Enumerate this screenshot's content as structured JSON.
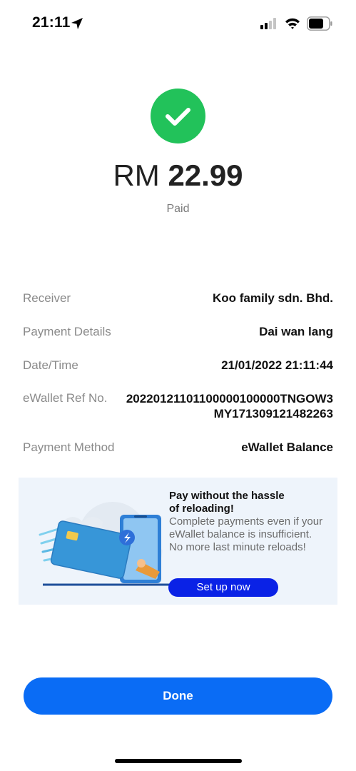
{
  "status_bar": {
    "time": "21:11",
    "icons": [
      "location-arrow-icon",
      "cellular-signal-icon",
      "wifi-icon",
      "battery-icon"
    ]
  },
  "result": {
    "icon": "check-circle-icon",
    "currency": "RM",
    "amount": "22.99",
    "status": "Paid",
    "accent_color": "#22c25a"
  },
  "details": {
    "receiver_label": "Receiver",
    "receiver_value": "Koo family sdn. Bhd.",
    "payment_details_label": "Payment Details",
    "payment_details_value": "Dai wan lang",
    "datetime_label": "Date/Time",
    "datetime_value": "21/01/2022 21:11:44",
    "ref_label": "eWallet Ref No.",
    "ref_value_line1": "20220121101100000100000TNGOW3",
    "ref_value_line2": "MY171309121482263",
    "method_label": "Payment Method",
    "method_value": "eWallet Balance"
  },
  "promo": {
    "title_line1": "Pay without the hassle",
    "title_line2": "of reloading!",
    "desc_line1": "Complete payments even if your",
    "desc_line2": "eWallet balance is insufficient.",
    "desc_line3": "No more last minute reloads!",
    "button_label": "Set up now",
    "button_color": "#0a22e6",
    "background_color": "#eef4fb"
  },
  "done_button": {
    "label": "Done",
    "color": "#0a6cf5"
  }
}
